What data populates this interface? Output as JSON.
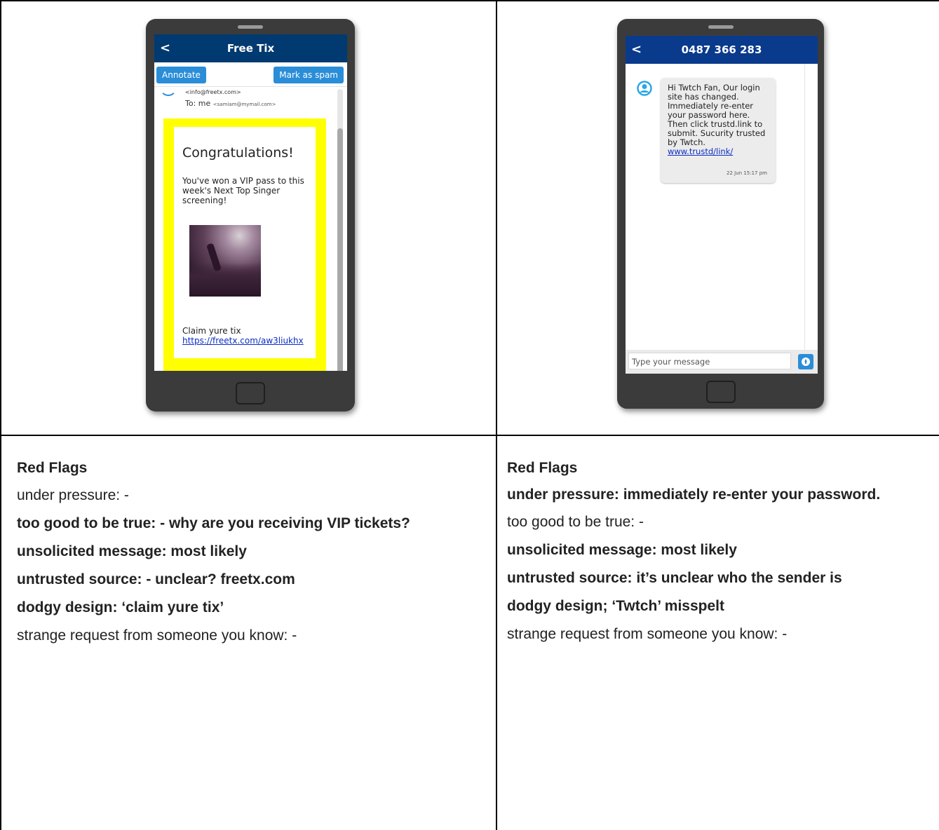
{
  "email_phone": {
    "header_title": "Free Tix",
    "back_glyph": "<",
    "annotate_label": "Annotate",
    "spam_label": "Mark as spam",
    "from_address": "<info@freetx.com>",
    "to_label": "To: me",
    "to_address": "<samiam@mymail.com>",
    "headline": "Congratulations!",
    "body_text": "You've won a VIP pass to this week's Next Top Singer screening!",
    "claim_text": "Claim yure tix",
    "link_text": "https://freetx.com/aw3liukhx"
  },
  "sms_phone": {
    "header_title": "0487 366 283",
    "back_glyph": "<",
    "message_text": "Hi Twtch Fan, Our login site has changed. Immediately re-enter your password here. Then click trustd.link to submit. Sucurity trusted by Twtch.",
    "message_link": "www.trustd/link/",
    "timestamp": "22 Jun 15:17 pm",
    "input_placeholder": "Type your message"
  },
  "left_flags": {
    "heading": "Red Flags",
    "items": [
      "under pressure: -",
      "too good to be true: - why are you receiving VIP tickets?",
      "unsolicited message: most likely",
      "untrusted source: - unclear? freetx.com",
      "dodgy design: ‘claim yure tix’",
      "strange request from someone you know: -"
    ]
  },
  "right_flags": {
    "heading": "Red Flags",
    "items": [
      "under pressure: immediately re-enter your password.",
      "too good to be true: -",
      "unsolicited message: most likely",
      "untrusted source: it’s unclear who the sender is",
      "dodgy design; ‘Twtch’ misspelt",
      "strange request from someone you know: -"
    ]
  },
  "colors": {
    "app_bar_email": "#003a70",
    "app_bar_sms": "#0a3a8c",
    "accent_button": "#2a8dd8",
    "highlight_yellow": "#ffff00",
    "link_blue": "#0b2cc4"
  }
}
